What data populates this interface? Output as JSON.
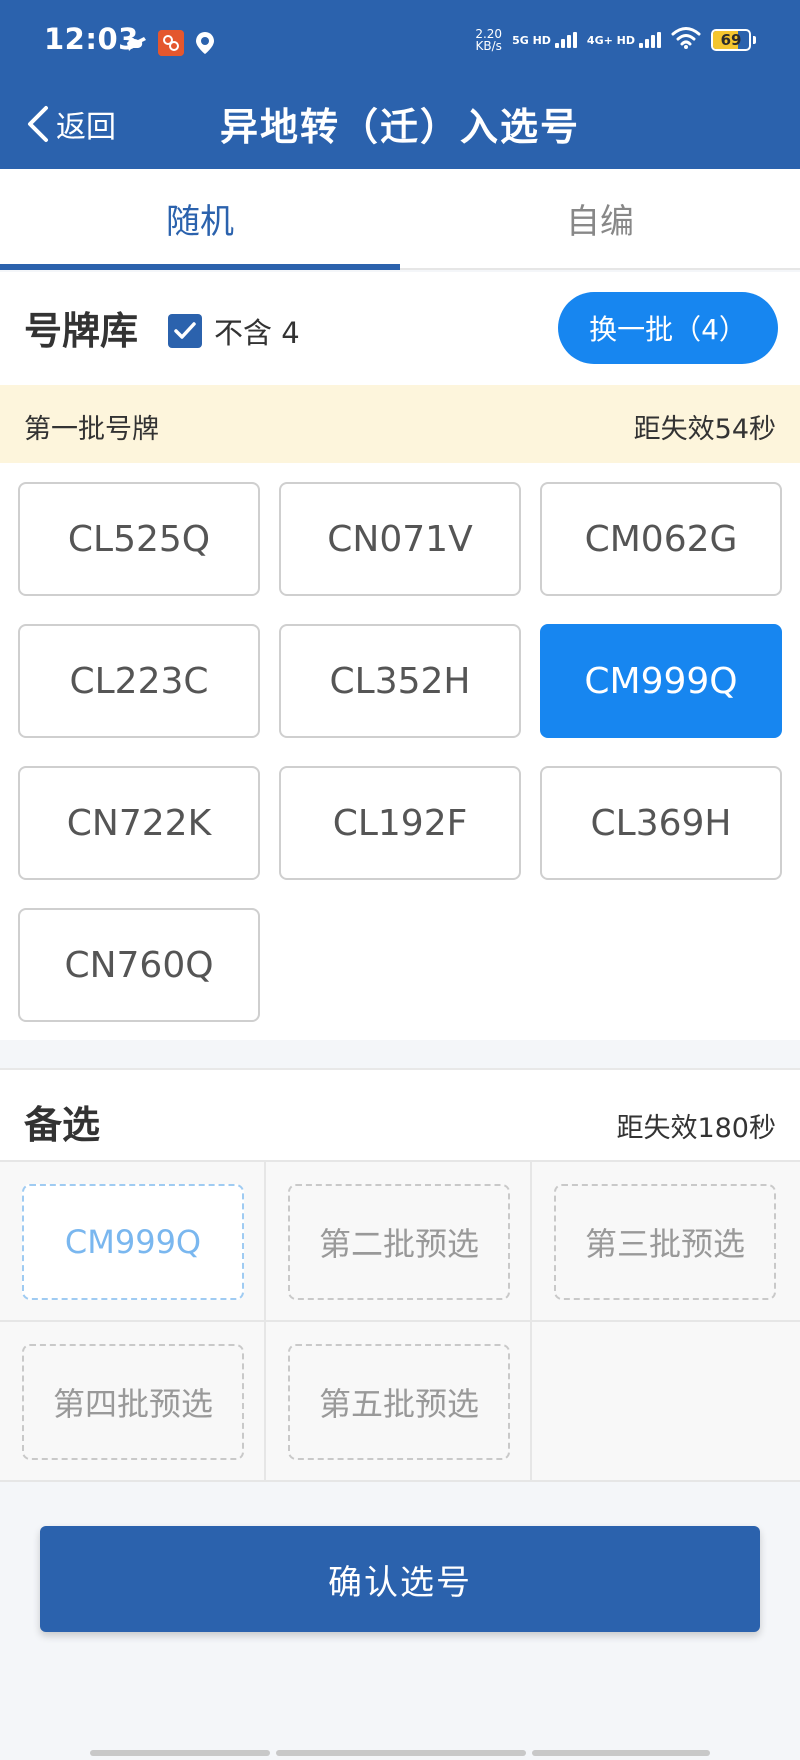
{
  "colors": {
    "primary": "#2b62ad",
    "accent": "#1786f0",
    "strip": "#fdf5dc"
  },
  "status_bar": {
    "time": "12:03",
    "net_speed_value": "2.20",
    "net_speed_unit": "KB/s",
    "sim1": "5G HD",
    "sim2": "4G+ HD",
    "battery": "69",
    "battery_level": 0.69,
    "left_icons": [
      "pet-icon",
      "app-badge-icon",
      "location-icon"
    ]
  },
  "nav": {
    "back_label": "返回",
    "title": "异地转（迁）入选号"
  },
  "tabs": [
    {
      "label": "随机",
      "active": true
    },
    {
      "label": "自编",
      "active": false
    }
  ],
  "pool": {
    "title": "号牌库",
    "exclude_four_label": "不含 4",
    "exclude_four_checked": true,
    "refresh_label": "换一批（4）"
  },
  "batch": {
    "label": "第一批号牌",
    "timer": "距失效54秒"
  },
  "plates": [
    {
      "number": "CL525Q",
      "selected": false
    },
    {
      "number": "CN071V",
      "selected": false
    },
    {
      "number": "CM062G",
      "selected": false
    },
    {
      "number": "CL223C",
      "selected": false
    },
    {
      "number": "CL352H",
      "selected": false
    },
    {
      "number": "CM999Q",
      "selected": true
    },
    {
      "number": "CN722K",
      "selected": false
    },
    {
      "number": "CL192F",
      "selected": false
    },
    {
      "number": "CL369H",
      "selected": false
    },
    {
      "number": "CN760Q",
      "selected": false
    }
  ],
  "alternates": {
    "title": "备选",
    "timer": "距失效180秒",
    "slots": [
      {
        "label": "CM999Q",
        "filled": true
      },
      {
        "label": "第二批预选",
        "filled": false
      },
      {
        "label": "第三批预选",
        "filled": false
      },
      {
        "label": "第四批预选",
        "filled": false
      },
      {
        "label": "第五批预选",
        "filled": false
      }
    ]
  },
  "confirm_label": "确认选号"
}
